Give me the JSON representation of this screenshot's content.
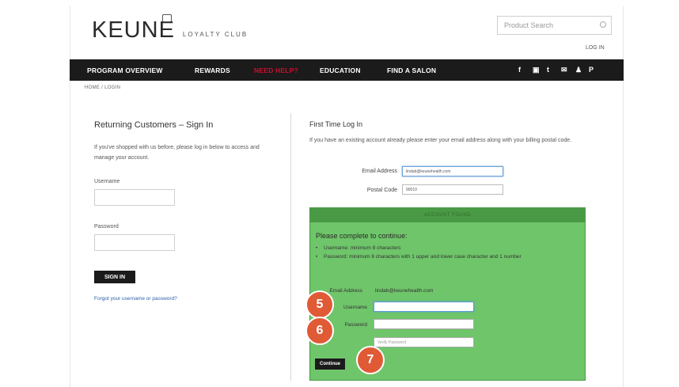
{
  "header": {
    "logo_text": "KEUNE",
    "logo_subtitle": "LOYALTY CLUB",
    "search_placeholder": "Product Search",
    "login_link": "LOG IN"
  },
  "nav": {
    "items": [
      {
        "label": "PROGRAM OVERVIEW"
      },
      {
        "label": "REWARDS"
      },
      {
        "label": "NEED HELP?",
        "active": true
      },
      {
        "label": "EDUCATION"
      },
      {
        "label": "FIND A SALON"
      }
    ],
    "social": [
      "f",
      "▣",
      "t",
      "✉",
      "♟",
      "P"
    ]
  },
  "breadcrumb": "HOME / LOGIN",
  "returning": {
    "title": "Returning Customers – Sign In",
    "description": "If you've shopped with us before, please log in below to access and manage your account.",
    "username_label": "Username",
    "password_label": "Password",
    "signin_button": "SIGN IN",
    "forgot_link": "Forgot your username or password?"
  },
  "first_time": {
    "title": "First Time Log In",
    "description": "If you have an existing account already please enter your email address along with your billing postal code.",
    "email_label": "Email Address",
    "email_value": "lindab@keunehealth.com",
    "postal_label": "Postal Code",
    "postal_value": "90010",
    "green_bar": "ACCOUNT FOUND",
    "complete_heading": "Please complete to continue:",
    "requirements": [
      "Username: minimum 8 characters",
      "Password: minimum 8 characters with 1 upper and lower case character and 1 number"
    ],
    "g_email_label": "Email Address",
    "g_email_value": "lindab@keunehealth.com",
    "g_username_label": "Username",
    "g_password_label": "Password",
    "verify_placeholder": "Verify Password",
    "continue_button": "Continue"
  },
  "steps": [
    "5",
    "6",
    "7"
  ]
}
